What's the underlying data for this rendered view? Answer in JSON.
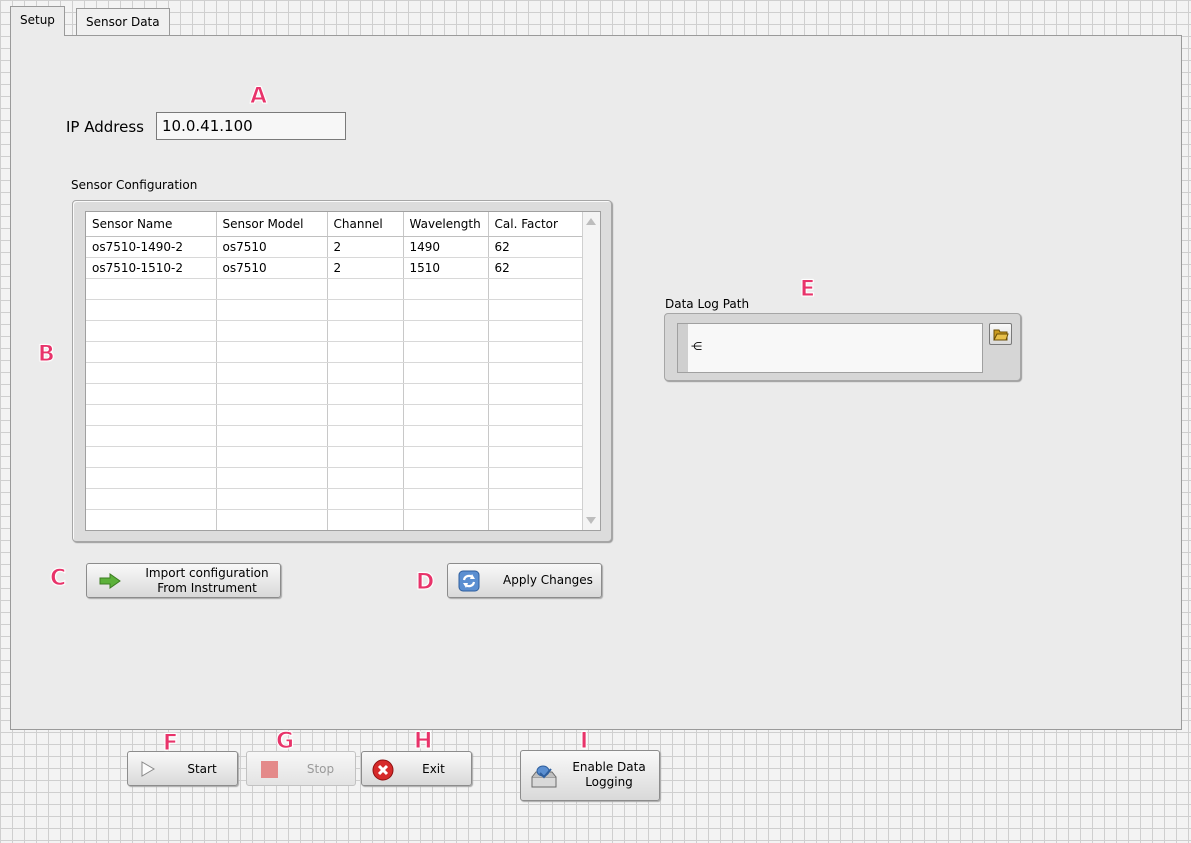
{
  "tabs": [
    {
      "label": "Setup",
      "active": true
    },
    {
      "label": "Sensor Data",
      "active": false
    }
  ],
  "markers": [
    "A",
    "B",
    "C",
    "D",
    "E",
    "F",
    "G",
    "H",
    "I"
  ],
  "ip": {
    "label": "IP Address",
    "value": "10.0.41.100"
  },
  "sensor_config": {
    "label": "Sensor Configuration",
    "columns": [
      "Sensor Name",
      "Sensor Model",
      "Channel",
      "Wavelength",
      "Cal. Factor"
    ],
    "rows": [
      [
        "os7510-1490-2",
        "os7510",
        "2",
        "1490",
        "62"
      ],
      [
        "os7510-1510-2",
        "os7510",
        "2",
        "1510",
        "62"
      ]
    ]
  },
  "buttons": {
    "import_line1": "Import configuration",
    "import_line2": "From Instrument",
    "apply": "Apply Changes",
    "start": "Start",
    "stop": "Stop",
    "exit": "Exit",
    "logging_line1": "Enable Data",
    "logging_line2": "Logging"
  },
  "data_log": {
    "label": "Data Log Path",
    "value": ""
  },
  "colors": {
    "marker": "#e8336a",
    "panel": "#ebebeb"
  },
  "icons": [
    "green-arrow-icon",
    "refresh-icon",
    "folder-icon",
    "play-icon",
    "stop-square-icon",
    "close-x-icon",
    "logging-icon"
  ]
}
